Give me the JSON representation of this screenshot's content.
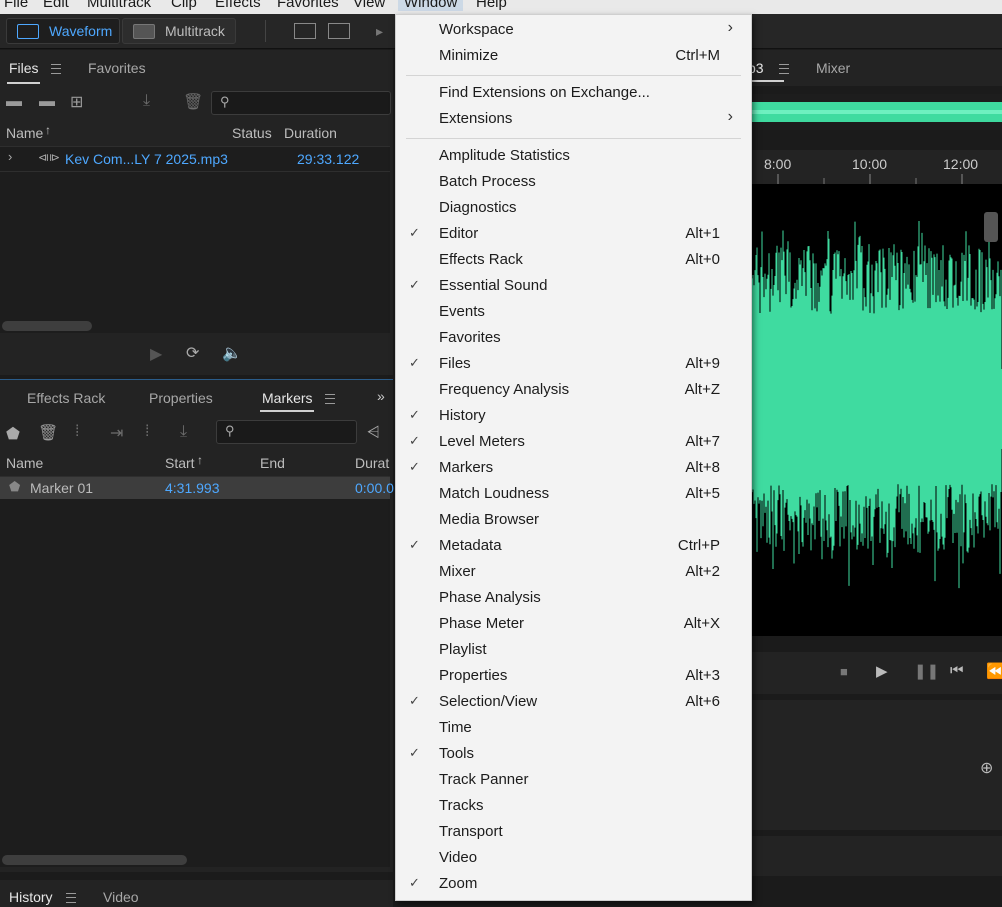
{
  "menubar": {
    "items": [
      "File",
      "Edit",
      "Multitrack",
      "Clip",
      "Effects",
      "Favorites",
      "View",
      "Window",
      "Help"
    ],
    "active": "Window"
  },
  "toolbar": {
    "waveform_label": "Waveform",
    "multitrack_label": "Multitrack"
  },
  "files_panel": {
    "tabs": [
      "Files",
      "Favorites"
    ],
    "columns": [
      "Name",
      "Status",
      "Duration"
    ],
    "rows": [
      {
        "name": "Kev Com...LY 7 2025.mp3",
        "duration": "29:33.122"
      }
    ]
  },
  "markers_panel": {
    "tabs": [
      "Effects Rack",
      "Properties",
      "Markers"
    ],
    "columns": [
      "Name",
      "Start",
      "End",
      "Durat"
    ],
    "rows": [
      {
        "name": "Marker 01",
        "start": "4:31.993",
        "duration": "0:00.0"
      }
    ]
  },
  "bottom_panel": {
    "tabs": [
      "History",
      "Video"
    ]
  },
  "editor": {
    "tab_partial": "p3",
    "mixer_label": "Mixer",
    "ruler": [
      "8:00",
      "10:00",
      "12:00"
    ],
    "wave_color": "#3fdba0"
  },
  "window_menu": {
    "items": [
      {
        "label": "Workspace",
        "submenu": true
      },
      {
        "label": "Minimize",
        "shortcut": "Ctrl+M"
      },
      {
        "sep": true
      },
      {
        "label": "Find Extensions on Exchange..."
      },
      {
        "label": "Extensions",
        "submenu": true
      },
      {
        "sep": true
      },
      {
        "label": "Amplitude Statistics"
      },
      {
        "label": "Batch Process"
      },
      {
        "label": "Diagnostics"
      },
      {
        "label": "Editor",
        "shortcut": "Alt+1",
        "checked": true
      },
      {
        "label": "Effects Rack",
        "shortcut": "Alt+0"
      },
      {
        "label": "Essential Sound",
        "checked": true
      },
      {
        "label": "Events"
      },
      {
        "label": "Favorites"
      },
      {
        "label": "Files",
        "shortcut": "Alt+9",
        "checked": true
      },
      {
        "label": "Frequency Analysis",
        "shortcut": "Alt+Z"
      },
      {
        "label": "History",
        "checked": true
      },
      {
        "label": "Level Meters",
        "shortcut": "Alt+7",
        "checked": true
      },
      {
        "label": "Markers",
        "shortcut": "Alt+8",
        "checked": true
      },
      {
        "label": "Match Loudness",
        "shortcut": "Alt+5"
      },
      {
        "label": "Media Browser"
      },
      {
        "label": "Metadata",
        "shortcut": "Ctrl+P",
        "checked": true
      },
      {
        "label": "Mixer",
        "shortcut": "Alt+2"
      },
      {
        "label": "Phase Analysis"
      },
      {
        "label": "Phase Meter",
        "shortcut": "Alt+X"
      },
      {
        "label": "Playlist"
      },
      {
        "label": "Properties",
        "shortcut": "Alt+3"
      },
      {
        "label": "Selection/View",
        "shortcut": "Alt+6",
        "checked": true
      },
      {
        "label": "Time"
      },
      {
        "label": "Tools",
        "checked": true
      },
      {
        "label": "Track Panner"
      },
      {
        "label": "Tracks"
      },
      {
        "label": "Transport"
      },
      {
        "label": "Video"
      },
      {
        "label": "Zoom",
        "checked": true
      }
    ]
  }
}
